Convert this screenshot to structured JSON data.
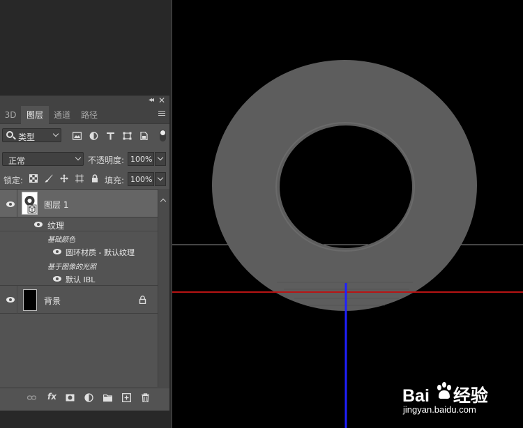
{
  "panel": {
    "tabs": [
      {
        "label": "3D",
        "active": false
      },
      {
        "label": "图层",
        "active": true
      },
      {
        "label": "通道",
        "active": false
      },
      {
        "label": "路径",
        "active": false
      }
    ],
    "filter_kind": "类型",
    "blend_mode": "正常",
    "opacity_label": "不透明度:",
    "opacity_value": "100%",
    "lock_label": "锁定:",
    "fill_label": "填充:",
    "fill_value": "100%"
  },
  "layers": {
    "layer1": {
      "name": "图层 1",
      "texture_group": "纹理",
      "base_color_label": "基础颜色",
      "material": "圆环材质 - 默认纹理",
      "ibl_label": "基于图像的光照",
      "ibl_item": "默认 IBL"
    },
    "background": {
      "name": "背景"
    }
  },
  "footer": {
    "fx": "fx"
  },
  "watermark": {
    "brand_a": "Bai",
    "brand_b": "经验",
    "site": "jingyan.baidu.com"
  },
  "colors": {
    "panel_bg": "#535353",
    "canvas_bg": "#000000",
    "torus": "#5c5c5c",
    "axis_x": "#c01010",
    "axis_z": "#1a1aff"
  }
}
